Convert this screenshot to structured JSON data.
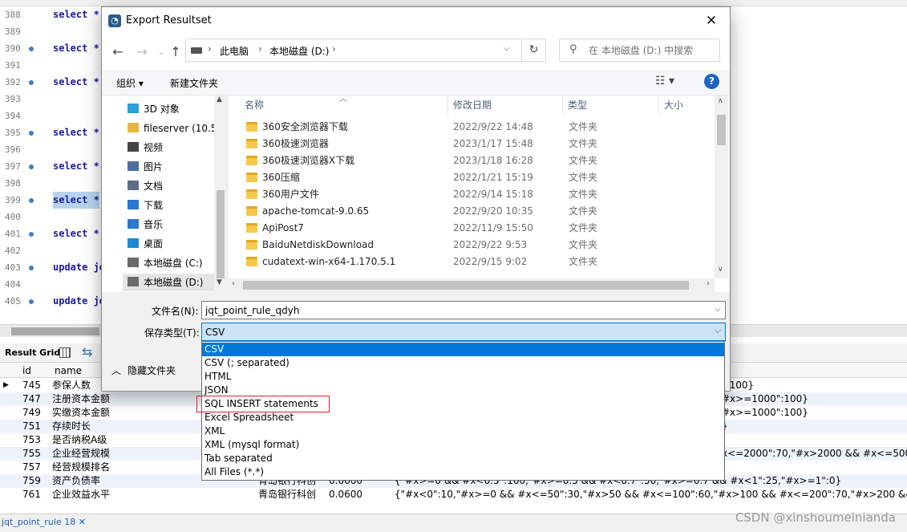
{
  "editor": {
    "lines": [
      {
        "n": "388",
        "dot": false,
        "code": "select *"
      },
      {
        "n": "389",
        "dot": false,
        "code": ""
      },
      {
        "n": "390",
        "dot": true,
        "code": "select *"
      },
      {
        "n": "391",
        "dot": false,
        "code": ""
      },
      {
        "n": "392",
        "dot": true,
        "code": "select *"
      },
      {
        "n": "393",
        "dot": false,
        "code": ""
      },
      {
        "n": "394",
        "dot": false,
        "code": ""
      },
      {
        "n": "395",
        "dot": true,
        "code": "select *"
      },
      {
        "n": "396",
        "dot": false,
        "code": ""
      },
      {
        "n": "397",
        "dot": true,
        "code": "select *"
      },
      {
        "n": "398",
        "dot": false,
        "code": ""
      },
      {
        "n": "399",
        "dot": true,
        "code": "select *",
        "highlight": true
      },
      {
        "n": "400",
        "dot": false,
        "code": ""
      },
      {
        "n": "401",
        "dot": true,
        "code": "select *"
      },
      {
        "n": "402",
        "dot": false,
        "code": ""
      },
      {
        "n": "403",
        "dot": true,
        "code": "update jq"
      },
      {
        "n": "404",
        "dot": false,
        "code": ""
      },
      {
        "n": "405",
        "dot": true,
        "code": "update jq"
      }
    ]
  },
  "result": {
    "toolbar_label": "Result Grid",
    "headers": {
      "id": "id",
      "name": "name"
    },
    "rows": [
      {
        "marker": "▶",
        "id": "745",
        "name": "参保人数",
        "bank": "",
        "val": "",
        "tail": "\":100}"
      },
      {
        "marker": "",
        "id": "747",
        "name": "注册资本金额",
        "bank": "",
        "val": "",
        "tail": "#x>=1000\":100}"
      },
      {
        "marker": "",
        "id": "749",
        "name": "实缴资本金额",
        "bank": "",
        "val": "",
        "tail": "#x>=1000\":100}"
      },
      {
        "marker": "",
        "id": "751",
        "name": "存续时长",
        "bank": "",
        "val": "",
        "tail": "}"
      },
      {
        "marker": "",
        "id": "753",
        "name": "是否纳税A级",
        "bank": "",
        "val": "",
        "tail": ""
      },
      {
        "marker": "",
        "id": "755",
        "name": "企业经营规模",
        "bank": "",
        "val": "",
        "tail": "x<=2000\":70,\"#x>2000 && #x<=5000\":80,\"#"
      },
      {
        "marker": "",
        "id": "757",
        "name": "经营规模排名",
        "bank": "",
        "val": "",
        "tail": ""
      },
      {
        "marker": "",
        "id": "759",
        "name": "资产负债率",
        "bank": "青岛银行科创",
        "val": "0.0600",
        "json": "{\"#x>=0 && #x<0.5\":100,\"#x>=0.5 && #x<0.7\":50,\"#x>=0.7 && #x<1\":25,\"#x>=1\":0}"
      },
      {
        "marker": "",
        "id": "761",
        "name": "企业效益水平",
        "bank": "青岛银行科创",
        "val": "0.0600",
        "json": "{\"#x<0\":10,\"#x>=0 && #x<=50\":30,\"#x>50 && #x<=100\":60,\"#x>100 && #x<=200\":70,\"#x>200 && #x<=500\":80,\"#x>500 &"
      }
    ],
    "bottom_tab": "jqt_point_rule 18 ✕"
  },
  "watermark": "CSDN @xinshoumeinianda",
  "dialog": {
    "title": "Export Resultset",
    "close_glyph": "✕",
    "address": {
      "crumbs": [
        "此电脑",
        "本地磁盘 (D:)"
      ]
    },
    "search_placeholder": "在 本地磁盘 (D:) 中搜索",
    "commands": {
      "organize": "组织 ▾",
      "new_folder": "新建文件夹",
      "help": "?"
    },
    "nav_items": [
      {
        "label": "3D 对象",
        "icon": "cube-icon",
        "color": "#2aa0d8"
      },
      {
        "label": "fileserver (10.5",
        "icon": "network-drive-icon",
        "color": "#e7b63a"
      },
      {
        "label": "视频",
        "icon": "video-icon",
        "color": "#444444"
      },
      {
        "label": "图片",
        "icon": "picture-icon",
        "color": "#4a6f9e"
      },
      {
        "label": "文档",
        "icon": "document-icon",
        "color": "#5a6f85"
      },
      {
        "label": "下载",
        "icon": "download-icon",
        "color": "#2b78d0"
      },
      {
        "label": "音乐",
        "icon": "music-icon",
        "color": "#2b78d0"
      },
      {
        "label": "桌面",
        "icon": "desktop-icon",
        "color": "#1e88d6"
      },
      {
        "label": "本地磁盘 (C:)",
        "icon": "drive-icon",
        "color": "#6a6a6a"
      },
      {
        "label": "本地磁盘 (D:)",
        "icon": "drive-icon",
        "color": "#6a6a6a",
        "selected": true
      }
    ],
    "columns": {
      "name": "名称",
      "date": "修改日期",
      "type": "类型",
      "size": "大小"
    },
    "files": [
      {
        "name": "360安全浏览器下载",
        "date": "2022/9/22 14:48",
        "type": "文件夹"
      },
      {
        "name": "360极速浏览器",
        "date": "2023/1/17 15:48",
        "type": "文件夹"
      },
      {
        "name": "360极速浏览器X下载",
        "date": "2023/1/18 16:28",
        "type": "文件夹"
      },
      {
        "name": "360压缩",
        "date": "2022/1/21 15:19",
        "type": "文件夹"
      },
      {
        "name": "360用户文件",
        "date": "2022/9/14 15:18",
        "type": "文件夹"
      },
      {
        "name": "apache-tomcat-9.0.65",
        "date": "2022/9/20 10:35",
        "type": "文件夹"
      },
      {
        "name": "ApiPost7",
        "date": "2022/11/9 15:50",
        "type": "文件夹"
      },
      {
        "name": "BaiduNetdiskDownload",
        "date": "2022/9/22 9:53",
        "type": "文件夹"
      },
      {
        "name": "cudatext-win-x64-1.170.5.1",
        "date": "2022/9/15 9:02",
        "type": "文件夹"
      }
    ],
    "filename_label": "文件名(N):",
    "filename_value": "jqt_point_rule_qdyh",
    "savetype_label": "保存类型(T):",
    "savetype_value": "CSV",
    "hide_folders": "隐藏文件夹",
    "type_options": [
      {
        "label": "CSV",
        "selected": true
      },
      {
        "label": "CSV (; separated)"
      },
      {
        "label": "HTML"
      },
      {
        "label": "JSON"
      },
      {
        "label": "SQL INSERT statements",
        "annotated": true
      },
      {
        "label": "Excel Spreadsheet"
      },
      {
        "label": "XML"
      },
      {
        "label": "XML (mysql format)"
      },
      {
        "label": "Tab separated"
      },
      {
        "label": "All Files (*.*)"
      }
    ]
  }
}
